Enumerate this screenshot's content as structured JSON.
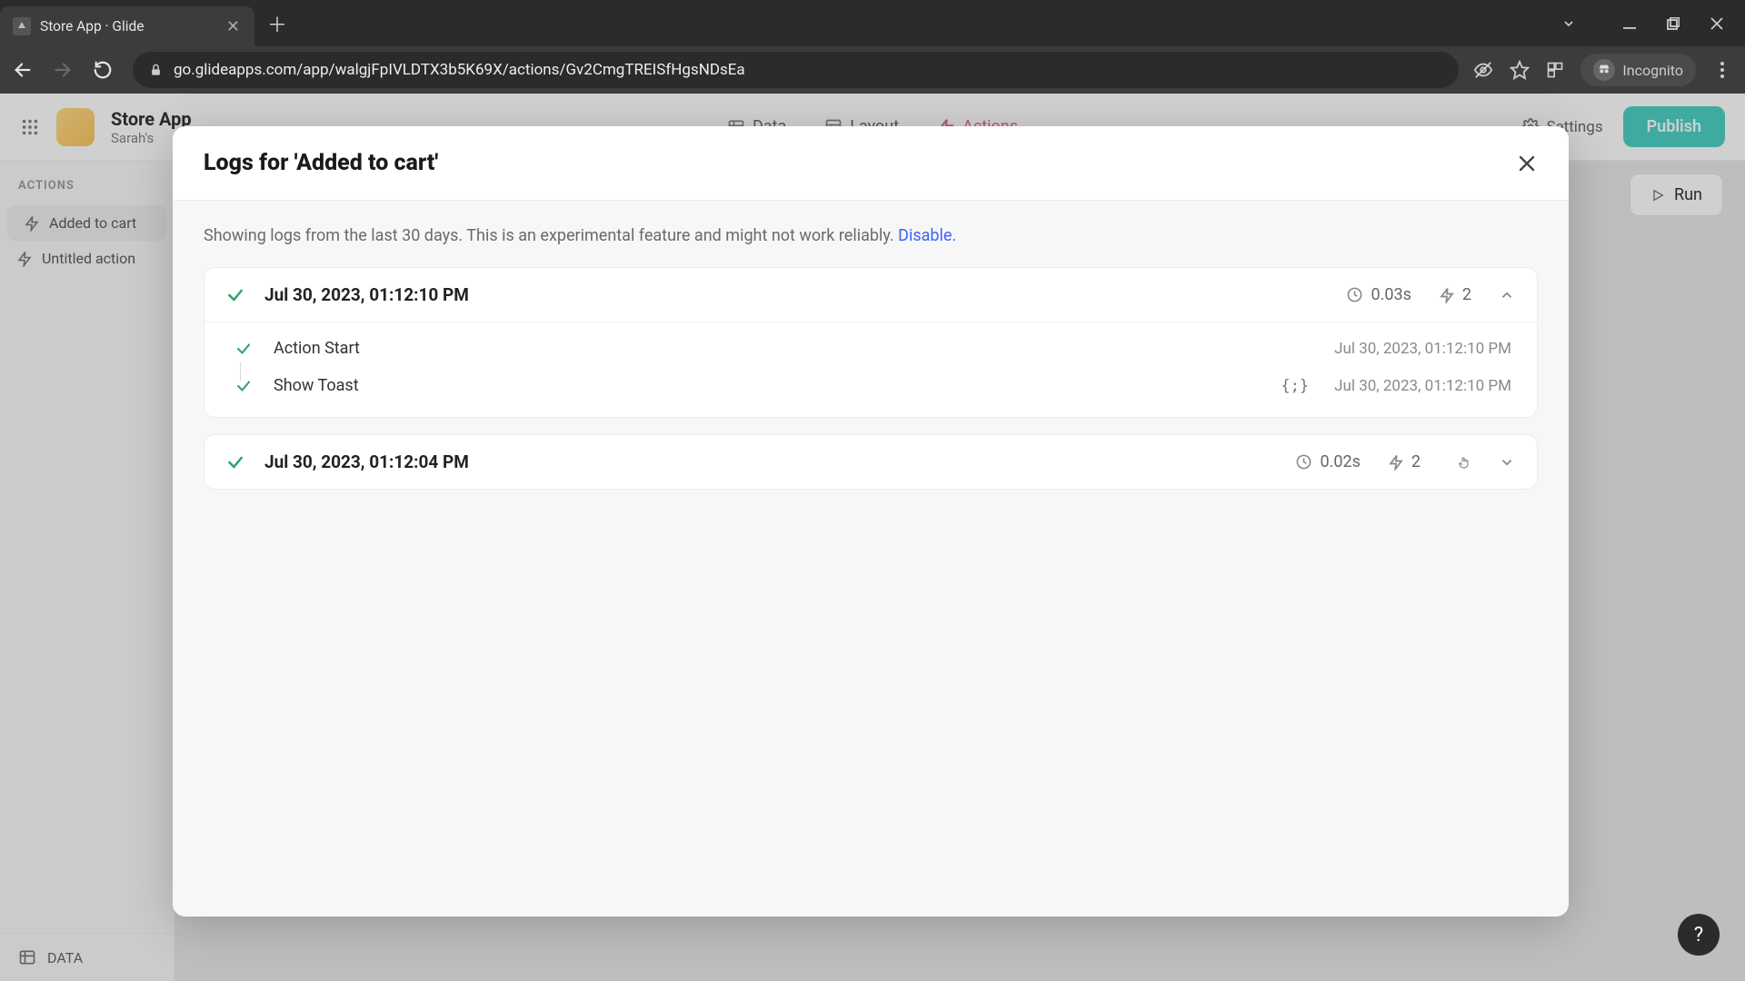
{
  "browser": {
    "tab_title": "Store App · Glide",
    "url": "go.glideapps.com/app/walgjFpIVLDTX3b5K69X/actions/Gv2CmgTREISfHgsNDsEa",
    "incognito_label": "Incognito"
  },
  "app_header": {
    "title": "Store App",
    "subtitle": "Sarah's",
    "tabs": {
      "data": "Data",
      "layout": "Layout",
      "actions": "Actions"
    },
    "settings": "Settings",
    "publish": "Publish"
  },
  "sidebar": {
    "label": "ACTIONS",
    "items": [
      {
        "label": "Added to cart"
      },
      {
        "label": "Untitled action"
      }
    ],
    "data_label": "DATA"
  },
  "run_button": "Run",
  "dialog": {
    "title": "Logs for 'Added to cart'",
    "intro_prefix": "Showing logs from the last 30 days. This is an experimental feature and might not work reliably. ",
    "intro_link": "Disable.",
    "logs": [
      {
        "timestamp": "Jul 30, 2023, 01:12:10 PM",
        "duration": "0.03s",
        "step_count": "2",
        "expanded": true,
        "steps": [
          {
            "name": "Action Start",
            "timestamp": "Jul 30, 2023, 01:12:10 PM",
            "has_data": false
          },
          {
            "name": "Show Toast",
            "timestamp": "Jul 30, 2023, 01:12:10 PM",
            "has_data": true
          }
        ]
      },
      {
        "timestamp": "Jul 30, 2023, 01:12:04 PM",
        "duration": "0.02s",
        "step_count": "2",
        "expanded": false
      }
    ]
  }
}
